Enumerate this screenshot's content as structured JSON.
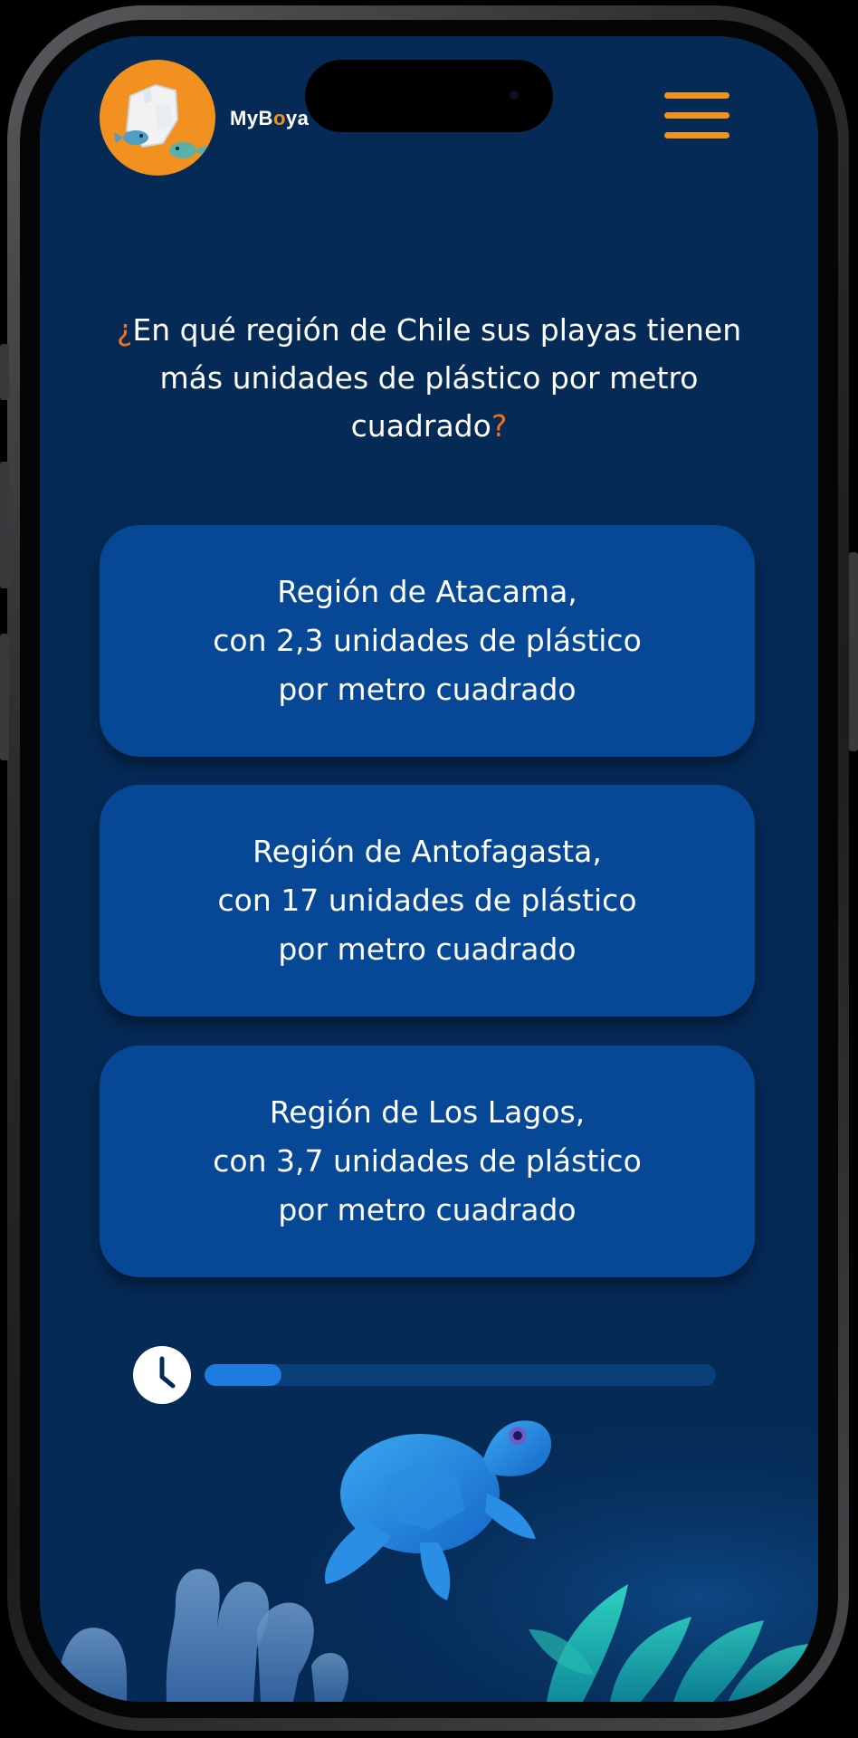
{
  "app": {
    "brand_prefix": "MyB",
    "brand_o": "o",
    "brand_suffix": "ya"
  },
  "question": {
    "lead_mark": "¿",
    "text": "En qué región de Chile sus playas tienen más unidades de plástico por metro cuadrado",
    "trail_mark": "?"
  },
  "options": [
    {
      "label": "Región de Atacama,\ncon 2,3 unidades de plástico\npor metro cuadrado"
    },
    {
      "label": "Región de Antofagasta,\ncon 17 unidades de plástico\npor metro cuadrado"
    },
    {
      "label": "Región de Los Lagos,\ncon 3,7 unidades de plástico\npor metro cuadrado"
    }
  ],
  "timer": {
    "icon": "clock-icon",
    "progress_fraction": 0.15
  },
  "colors": {
    "background": "#052a55",
    "accent_orange": "#f29120",
    "option_card": "#064796",
    "progress_fill": "#1e7be0",
    "progress_track": "#0b3f7a"
  }
}
